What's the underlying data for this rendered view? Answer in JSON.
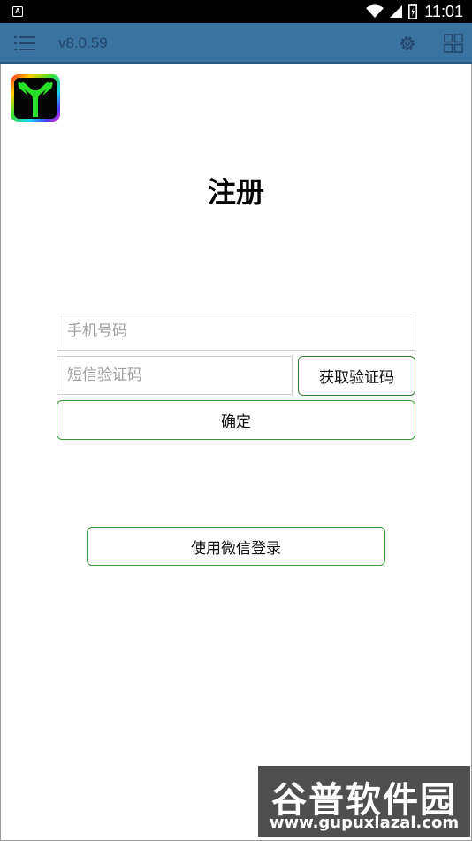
{
  "statusbar": {
    "notification_glyph": "A",
    "time": "11:01",
    "icons": [
      "wifi-icon",
      "signal-icon",
      "battery-icon"
    ]
  },
  "toolbar": {
    "version": "v8.0.59",
    "icons": [
      "menu-icon",
      "gear-icon",
      "grid-icon"
    ]
  },
  "page": {
    "title": "注册"
  },
  "form": {
    "phone_placeholder": "手机号码",
    "sms_placeholder": "短信验证码",
    "get_code_label": "获取验证码",
    "confirm_label": "确定",
    "wechat_label": "使用微信登录"
  },
  "watermark": {
    "title": "谷普软件园",
    "url": "www.gupuxlazal.com"
  },
  "colors": {
    "toolbar": "#3a73a0",
    "button_border": "#3a9a3a",
    "statusbar": "#000000"
  }
}
